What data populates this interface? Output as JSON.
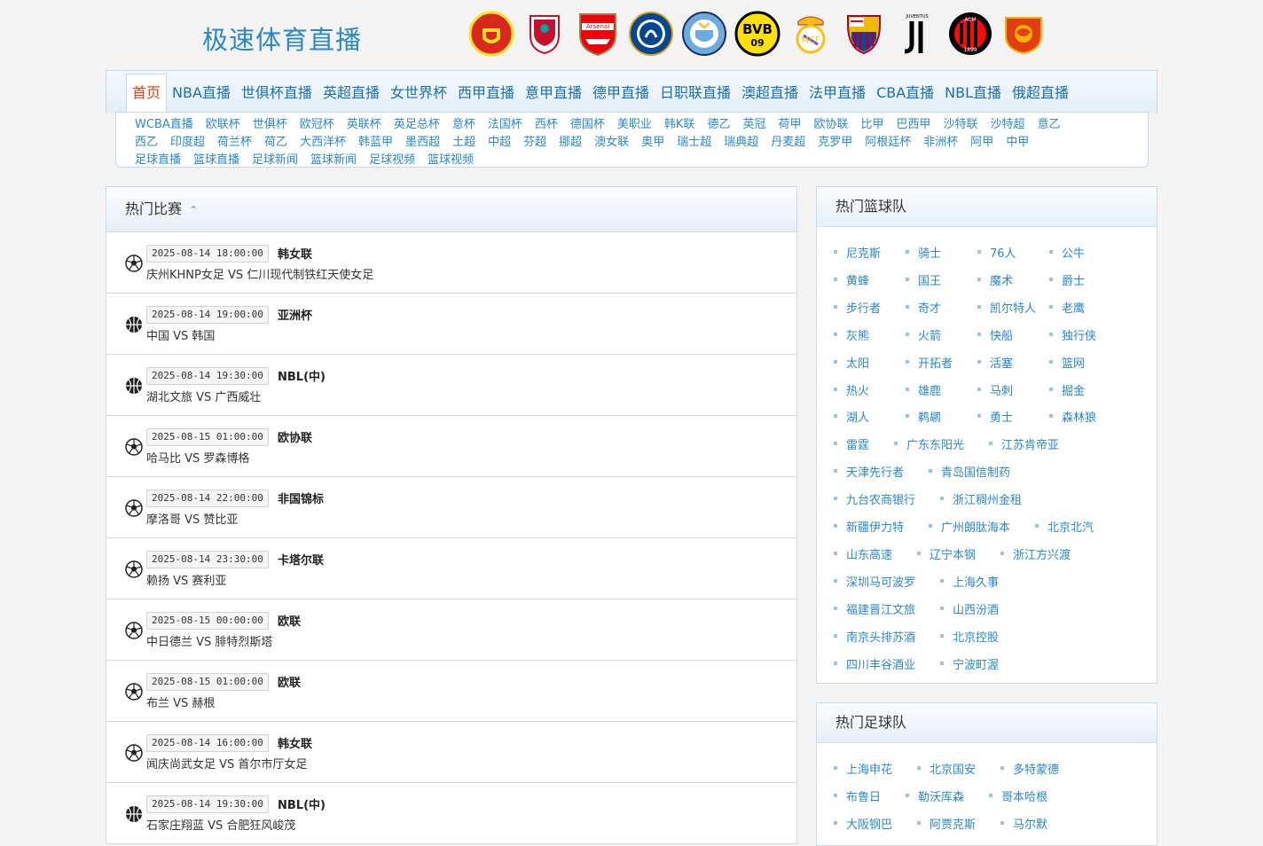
{
  "site": {
    "title": "极速体育直播"
  },
  "logos": [
    {
      "name": "manchester-united-logo",
      "color": "#da291c"
    },
    {
      "name": "liverpool-logo",
      "color": "#c8102e"
    },
    {
      "name": "arsenal-logo",
      "color": "#ef0107"
    },
    {
      "name": "chelsea-logo",
      "color": "#034694"
    },
    {
      "name": "manchester-city-logo",
      "color": "#6cabdd"
    },
    {
      "name": "bvb-logo",
      "color": "#fde100"
    },
    {
      "name": "real-madrid-logo",
      "color": "#febe10"
    },
    {
      "name": "barcelona-logo",
      "color": "#a50044"
    },
    {
      "name": "juventus-logo",
      "color": "#000000"
    },
    {
      "name": "ac-milan-logo",
      "color": "#fb090b"
    },
    {
      "name": "guangzhou-logo",
      "color": "#e33e12"
    }
  ],
  "logo_text": {
    "arsenal": "Arsenal",
    "bvb": "BVB",
    "bvb09": "09",
    "juventus": "JUVENTUS",
    "acm": "ACM",
    "milan_year": "1899"
  },
  "nav": {
    "main": [
      "首页",
      "NBA直播",
      "世俱杯直播",
      "英超直播",
      "女世界杯",
      "西甲直播",
      "意甲直播",
      "德甲直播",
      "日职联直播",
      "澳超直播",
      "法甲直播",
      "CBA直播",
      "NBL直播",
      "俄超直播"
    ],
    "sub_row1": [
      "WCBA直播",
      "欧联杯",
      "世俱杯",
      "欧冠杯",
      "英联杯",
      "英足总杯",
      "意杯",
      "法国杯",
      "西杯",
      "德国杯",
      "美职业",
      "韩K联",
      "德乙",
      "英冠",
      "荷甲",
      "欧协联",
      "比甲",
      "巴西甲",
      "沙特联",
      "沙特超",
      "意乙"
    ],
    "sub_row2": [
      "西乙",
      "印度超",
      "荷兰杯",
      "荷乙",
      "大西洋杯",
      "韩蓝甲",
      "墨西超",
      "土超",
      "中超",
      "芬超",
      "挪超",
      "澳女联",
      "奥甲",
      "瑞士超",
      "瑞典超",
      "丹麦超",
      "克罗甲",
      "阿根廷杯",
      "非洲杯",
      "阿甲",
      "中甲"
    ],
    "sub_row3": [
      "足球直播",
      "篮球直播",
      "足球新闻",
      "篮球新闻",
      "足球视频",
      "篮球视频"
    ]
  },
  "hot_matches": {
    "title": "热门比赛",
    "items": [
      {
        "sport": "soccer",
        "time": "2025-08-14 18:00:00",
        "league": "韩女联",
        "teams": "庆州KHNP女足 VS 仁川现代制铁红天使女足"
      },
      {
        "sport": "basketball",
        "time": "2025-08-14 19:00:00",
        "league": "亚洲杯",
        "teams": "中国 VS 韩国"
      },
      {
        "sport": "basketball",
        "time": "2025-08-14 19:30:00",
        "league": "NBL(中)",
        "teams": "湖北文旅 VS 广西威壮"
      },
      {
        "sport": "soccer",
        "time": "2025-08-15 01:00:00",
        "league": "欧协联",
        "teams": "哈马比 VS 罗森博格"
      },
      {
        "sport": "soccer",
        "time": "2025-08-14 22:00:00",
        "league": "非国锦标",
        "teams": "摩洛哥 VS 赞比亚"
      },
      {
        "sport": "soccer",
        "time": "2025-08-14 23:30:00",
        "league": "卡塔尔联",
        "teams": "赖扬 VS 赛利亚"
      },
      {
        "sport": "soccer",
        "time": "2025-08-15 00:00:00",
        "league": "欧联",
        "teams": "中日德兰 VS 腓特烈斯塔"
      },
      {
        "sport": "soccer",
        "time": "2025-08-15 01:00:00",
        "league": "欧联",
        "teams": "布兰 VS 赫根"
      },
      {
        "sport": "soccer",
        "time": "2025-08-14 16:00:00",
        "league": "韩女联",
        "teams": "闻庆尚武女足 VS 首尔市厅女足"
      },
      {
        "sport": "basketball",
        "time": "2025-08-14 19:30:00",
        "league": "NBL(中)",
        "teams": "石家庄翔蓝 VS 合肥狂风峻茂"
      }
    ]
  },
  "hot_basketball": {
    "title": "热门篮球队",
    "rows": [
      [
        "尼克斯",
        "骑士",
        "76人",
        "公牛"
      ],
      [
        "黄蜂",
        "国王",
        "魔术",
        "爵士"
      ],
      [
        "步行者",
        "奇才",
        "凯尔特人",
        "老鹰"
      ],
      [
        "灰熊",
        "火箭",
        "快船",
        "独行侠"
      ],
      [
        "太阳",
        "开拓者",
        "活塞",
        "篮网"
      ],
      [
        "热火",
        "雄鹿",
        "马刺",
        "掘金"
      ],
      [
        "湖人",
        "鹈鹕",
        "勇士",
        "森林狼"
      ],
      [
        "雷霆",
        "广东东阳光",
        "江苏肯帝亚"
      ],
      [
        "天津先行者",
        "青岛国信制药"
      ],
      [
        "九台农商银行",
        "浙江稠州金租"
      ],
      [
        "新疆伊力特",
        "广州朗肽海本",
        "北京北汽"
      ],
      [
        "山东高速",
        "辽宁本钢",
        "浙江方兴渡"
      ],
      [
        "深圳马可波罗",
        "上海久事"
      ],
      [
        "福建晋江文旅",
        "山西汾酒"
      ],
      [
        "南京头排苏酒",
        "北京控股"
      ],
      [
        "四川丰谷酒业",
        "宁波町渥"
      ]
    ]
  },
  "hot_football": {
    "title": "热门足球队",
    "rows": [
      [
        "上海申花",
        "北京国安",
        "多特蒙德"
      ],
      [
        "布鲁日",
        "勒沃库森",
        "哥本哈根"
      ],
      [
        "大阪钢巴",
        "阿贾克斯",
        "马尔默"
      ]
    ]
  }
}
